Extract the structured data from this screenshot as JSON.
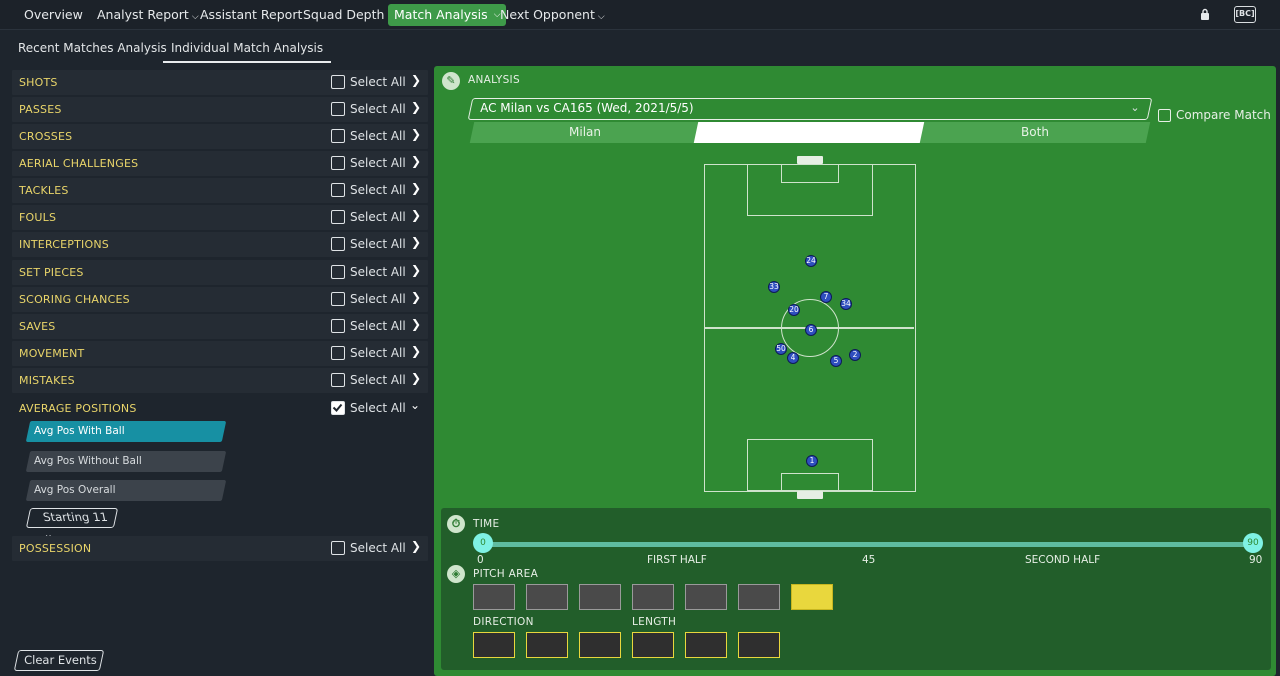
{
  "nav": {
    "items": [
      {
        "label": "Overview"
      },
      {
        "label": "Analyst Report"
      },
      {
        "label": "Assistant Report"
      },
      {
        "label": "Squad Depth"
      },
      {
        "label": "Match Analysis"
      },
      {
        "label": "Next Opponent"
      }
    ],
    "active": "Match Analysis",
    "badge": "[BC]"
  },
  "subtabs": [
    "Recent Matches Analysis",
    "Individual Match Analysis"
  ],
  "active_subtab": "Individual Match Analysis",
  "events": [
    {
      "label": "SHOTS",
      "select": "Select All",
      "checked": false
    },
    {
      "label": "PASSES",
      "select": "Select All",
      "checked": false
    },
    {
      "label": "CROSSES",
      "select": "Select All",
      "checked": false
    },
    {
      "label": "AERIAL CHALLENGES",
      "select": "Select All",
      "checked": false
    },
    {
      "label": "TACKLES",
      "select": "Select All",
      "checked": false
    },
    {
      "label": "FOULS",
      "select": "Select All",
      "checked": false
    },
    {
      "label": "INTERCEPTIONS",
      "select": "Select All",
      "checked": false
    },
    {
      "label": "SET PIECES",
      "select": "Select All",
      "checked": false
    },
    {
      "label": "SCORING CHANCES",
      "select": "Select All",
      "checked": false
    },
    {
      "label": "SAVES",
      "select": "Select All",
      "checked": false
    },
    {
      "label": "MOVEMENT",
      "select": "Select All",
      "checked": false
    },
    {
      "label": "MISTAKES",
      "select": "Select All",
      "checked": false
    },
    {
      "label": "AVERAGE POSITIONS",
      "select": "Select All",
      "checked": true
    }
  ],
  "avg_positions": {
    "options": [
      "Avg Pos With Ball",
      "Avg Pos Without Ball",
      "Avg Pos Overall"
    ],
    "selected": "Avg Pos With Ball",
    "lineup": "Starting 11"
  },
  "possession": {
    "label": "POSSESSION",
    "select": "Select All",
    "checked": false
  },
  "clear_events": "Clear Events",
  "analysis": {
    "title": "ANALYSIS",
    "match": "AC Milan vs CA165 (Wed, 2021/5/5)",
    "compare": "Compare Match",
    "team_tabs": [
      "Milan",
      "",
      "Both"
    ],
    "selected_tab_index": 1,
    "players": [
      "24",
      "33",
      "7",
      "34",
      "20",
      "6",
      "50",
      "4",
      "5",
      "2",
      "1"
    ]
  },
  "time": {
    "title": "TIME",
    "start": "0",
    "end": "90",
    "labels": [
      "0",
      "FIRST HALF",
      "45",
      "SECOND HALF",
      "90"
    ],
    "range": [
      0,
      90
    ]
  },
  "pitch_area": {
    "title": "PITCH AREA",
    "selected_index": 6,
    "count": 7
  },
  "direction": {
    "title": "DIRECTION"
  },
  "length": {
    "title": "LENGTH"
  },
  "colors": {
    "accent_green": "#3e9a49",
    "pitch": "#2f8a33",
    "label_yellow": "#e9d56a",
    "selected_pill": "#1790a3"
  }
}
